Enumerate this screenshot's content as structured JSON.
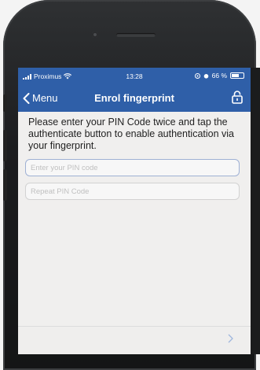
{
  "status_bar": {
    "carrier": "Proximus",
    "time": "13:28",
    "battery_text": "66 %",
    "battery_level": 0.66
  },
  "nav": {
    "back_label": "Menu",
    "title": "Enrol fingerprint",
    "lock_icon": "lock-open-icon"
  },
  "main": {
    "instructions": "Please enter your PIN Code twice and tap the authenticate button to enable authentication via your fingerprint.",
    "pin_field": {
      "placeholder": "Enter your PIN code",
      "value": ""
    },
    "repeat_field": {
      "placeholder": "Repeat PIN Code",
      "value": ""
    }
  },
  "bottom": {
    "next_icon": "chevron-right-icon"
  },
  "colors": {
    "nav_blue": "#2f5fa8",
    "screen_bg": "#f0efee",
    "accent_light": "#9fb7dd"
  }
}
